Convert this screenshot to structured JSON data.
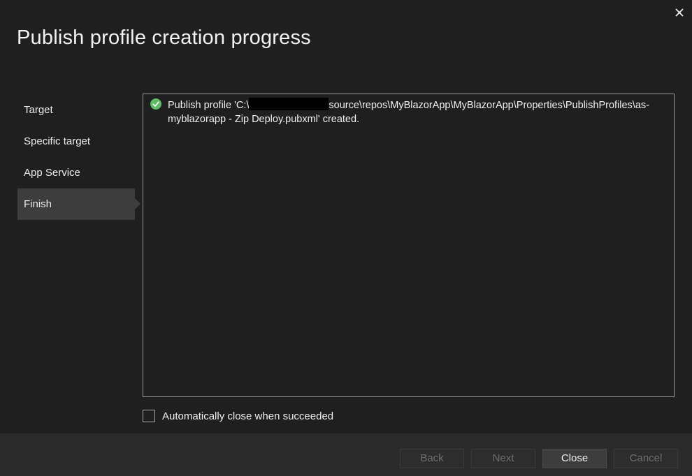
{
  "dialog": {
    "title": "Publish profile creation progress",
    "close_icon": "close-icon"
  },
  "steps": [
    {
      "label": "Target",
      "active": false
    },
    {
      "label": "Specific target",
      "active": false
    },
    {
      "label": "App Service",
      "active": false
    },
    {
      "label": "Finish",
      "active": true
    }
  ],
  "log": {
    "entries": [
      {
        "status_icon": "check-circle-icon",
        "status_color": "#5dbb63",
        "text_before_redaction": "Publish profile 'C:\\",
        "text_after_redaction": "source\\repos\\MyBlazorApp\\MyBlazorApp\\Properties\\PublishProfiles\\as-myblazorapp - Zip Deploy.pubxml' created."
      }
    ]
  },
  "options": {
    "auto_close_label": "Automatically close when succeeded",
    "auto_close_checked": false
  },
  "buttons": {
    "back": "Back",
    "next": "Next",
    "close": "Close",
    "cancel": "Cancel"
  },
  "colors": {
    "background": "#1f1f1f",
    "footer": "#2b2b2b",
    "active_step": "#3d3d3d",
    "success": "#5dbb63"
  }
}
